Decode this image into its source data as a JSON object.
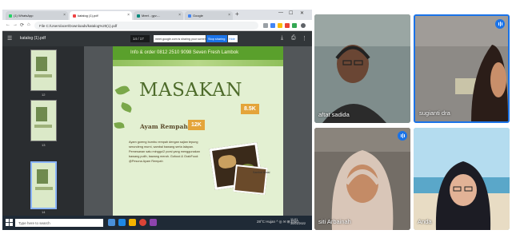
{
  "browser": {
    "tabs": [
      {
        "label": "(1) WhatsApp",
        "icon": "whatsapp-icon",
        "color": "#25d366"
      },
      {
        "label": "katalog (1).pdf",
        "icon": "pdf-icon",
        "color": "#e44"
      },
      {
        "label": "Meet - gyv-...",
        "icon": "meet-icon",
        "color": "#00897b"
      },
      {
        "label": "Google",
        "icon": "google-icon",
        "color": "#4285f4"
      }
    ],
    "url": "File  C:/Users/acer/Downloads/katalog%20(1).pdf"
  },
  "pdf": {
    "file_name": "katalog (1).pdf",
    "page_indicator": "14 / 17",
    "share_message": "meet.google.com is sharing your screen",
    "stop_sharing_label": "Stop sharing",
    "hide_label": "Hide",
    "thumb_numbers": [
      "12",
      "13",
      "14",
      "15"
    ]
  },
  "catalog_page": {
    "info_line": "Info & order  0812 2510 9098    Seven Fresh Lambok",
    "title": "MASAKAN",
    "price_main": "12K",
    "price_side": "8.5K",
    "dish_name": "Ayam Rempah",
    "description": "Ayam goreng bumbu rempah dengan sajian tepung serundeng murni, sambal bawang serta lalapan. Pemesanan satu minggu/2 porsi yang menggunakan bawang putih, bawang merah. Gofood & GrabFood: @Pesona Ayam Rempah",
    "side_label": "Sambal terasi"
  },
  "taskbar": {
    "search_placeholder": "Type here to search",
    "tray_text": "28°C Hujan  ^  ◎  ✉  ⊞  ENG",
    "time": "11:01",
    "date": "30/01/2022"
  },
  "participants": [
    {
      "name": "aftat sadida",
      "speaking": false
    },
    {
      "name": "sugianti dra",
      "speaking": true
    },
    {
      "name": "siti Arbainah",
      "speaking": true
    },
    {
      "name": "Anda",
      "speaking": false
    }
  ],
  "colors": {
    "page_green": "#5aa02c",
    "price_orange": "#e4a43a",
    "meet_blue": "#1a73e8"
  }
}
